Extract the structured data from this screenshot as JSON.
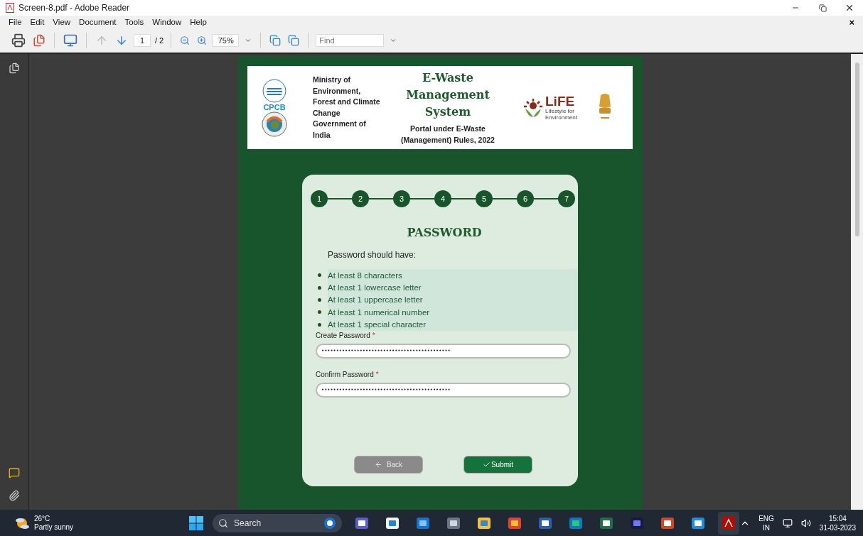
{
  "window": {
    "title": "Screen-8.pdf - Adobe Reader"
  },
  "menu": {
    "items": [
      "File",
      "Edit",
      "View",
      "Document",
      "Tools",
      "Window",
      "Help"
    ],
    "close_glyph": "×"
  },
  "toolbar": {
    "page": "1",
    "page_total": "/ 2",
    "zoom": "75%",
    "find_placeholder": "Find"
  },
  "header": {
    "cpcb_label": "CPCB",
    "ministry": "Ministry of Environment, Forest and Climate Change Government of India",
    "title": "E-Waste Management System",
    "subtitle": "Portal under E-Waste (Management) Rules, 2022",
    "life_label": "LiFE",
    "life_tagline": "Lifestyle for Environment"
  },
  "steps": [
    {
      "label": "1"
    },
    {
      "label": "2"
    },
    {
      "label": "3"
    },
    {
      "label": "4"
    },
    {
      "label": "5"
    },
    {
      "label": "6"
    },
    {
      "label": "7"
    }
  ],
  "form": {
    "title": "PASSWORD",
    "rules_intro": "Password should have:",
    "rules": [
      "At least 8 characters",
      "At least 1 lowercase letter",
      "At least 1 uppercase letter",
      "At least 1 numerical number",
      "At least 1 special character"
    ],
    "fields": [
      {
        "label": "Create Password",
        "required": true,
        "required_mark": "*",
        "value": "••••••••••••••••••••••••••••••••••••••••••••"
      },
      {
        "label": "Confirm Password",
        "required": true,
        "required_mark": "*",
        "value": "••••••••••••••••••••••••••••••••••••••••••••"
      }
    ],
    "back_button": "Back",
    "submit_button": "Submit"
  },
  "taskbar": {
    "temperature": "26°C",
    "weather": "Partly sunny",
    "search_placeholder": "Search",
    "language": "ENG",
    "region": "IN",
    "time": "15:04",
    "date": "31-03-2023"
  }
}
